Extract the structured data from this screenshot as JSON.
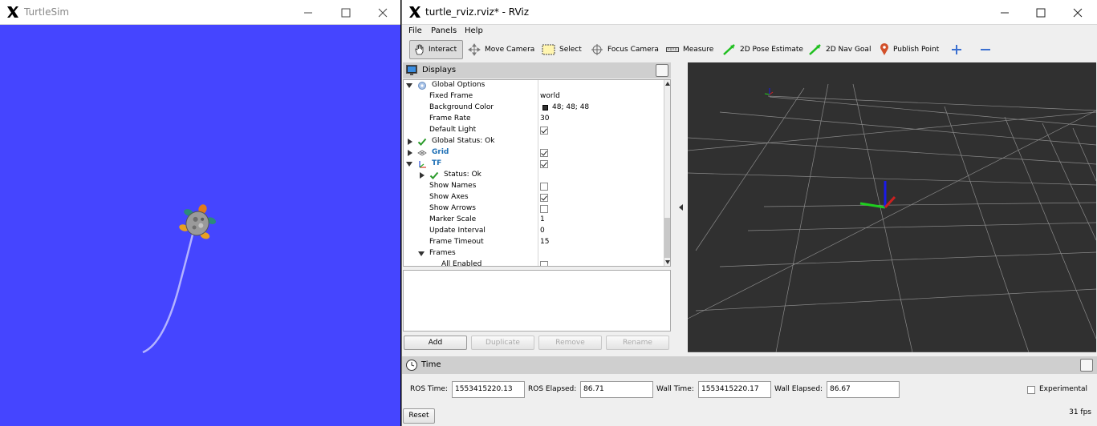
{
  "turtlesim": {
    "title": "TurtleSim",
    "background": "#4545ff",
    "trail_color": "#b3b3ff"
  },
  "rviz": {
    "title": "turtle_rviz.rviz* - RViz",
    "menu": [
      "File",
      "Panels",
      "Help"
    ],
    "toolbar": {
      "interact": "Interact",
      "move_camera": "Move Camera",
      "select": "Select",
      "focus_camera": "Focus Camera",
      "measure": "Measure",
      "pose_estimate": "2D Pose Estimate",
      "nav_goal": "2D Nav Goal",
      "publish_point": "Publish Point"
    },
    "displays": {
      "title": "Displays",
      "rows": [
        {
          "name": "Global Options",
          "value": ""
        },
        {
          "name": "Fixed Frame",
          "value": "world"
        },
        {
          "name": "Background Color",
          "value": "48; 48; 48"
        },
        {
          "name": "Frame Rate",
          "value": "30"
        },
        {
          "name": "Default Light",
          "value": ""
        },
        {
          "name": "Global Status: Ok",
          "value": ""
        },
        {
          "name": "Grid",
          "value": ""
        },
        {
          "name": "TF",
          "value": ""
        },
        {
          "name": "Status: Ok",
          "value": ""
        },
        {
          "name": "Show Names",
          "value": ""
        },
        {
          "name": "Show Axes",
          "value": ""
        },
        {
          "name": "Show Arrows",
          "value": ""
        },
        {
          "name": "Marker Scale",
          "value": "1"
        },
        {
          "name": "Update Interval",
          "value": "0"
        },
        {
          "name": "Frame Timeout",
          "value": "15"
        },
        {
          "name": "Frames",
          "value": ""
        },
        {
          "name": "All Enabled",
          "value": ""
        }
      ],
      "buttons": {
        "add": "Add",
        "duplicate": "Duplicate",
        "remove": "Remove",
        "rename": "Rename"
      }
    },
    "time": {
      "title": "Time",
      "ros_time_label": "ROS Time:",
      "ros_time": "1553415220.13",
      "ros_elapsed_label": "ROS Elapsed:",
      "ros_elapsed": "86.71",
      "wall_time_label": "Wall Time:",
      "wall_time": "1553415220.17",
      "wall_elapsed_label": "Wall Elapsed:",
      "wall_elapsed": "86.67",
      "experimental": "Experimental",
      "reset": "Reset",
      "fps": "31 fps"
    },
    "colors": {
      "view_background": "#303030",
      "link_blue": "#1d6fb5",
      "check_green": "#2a9a2a"
    }
  }
}
